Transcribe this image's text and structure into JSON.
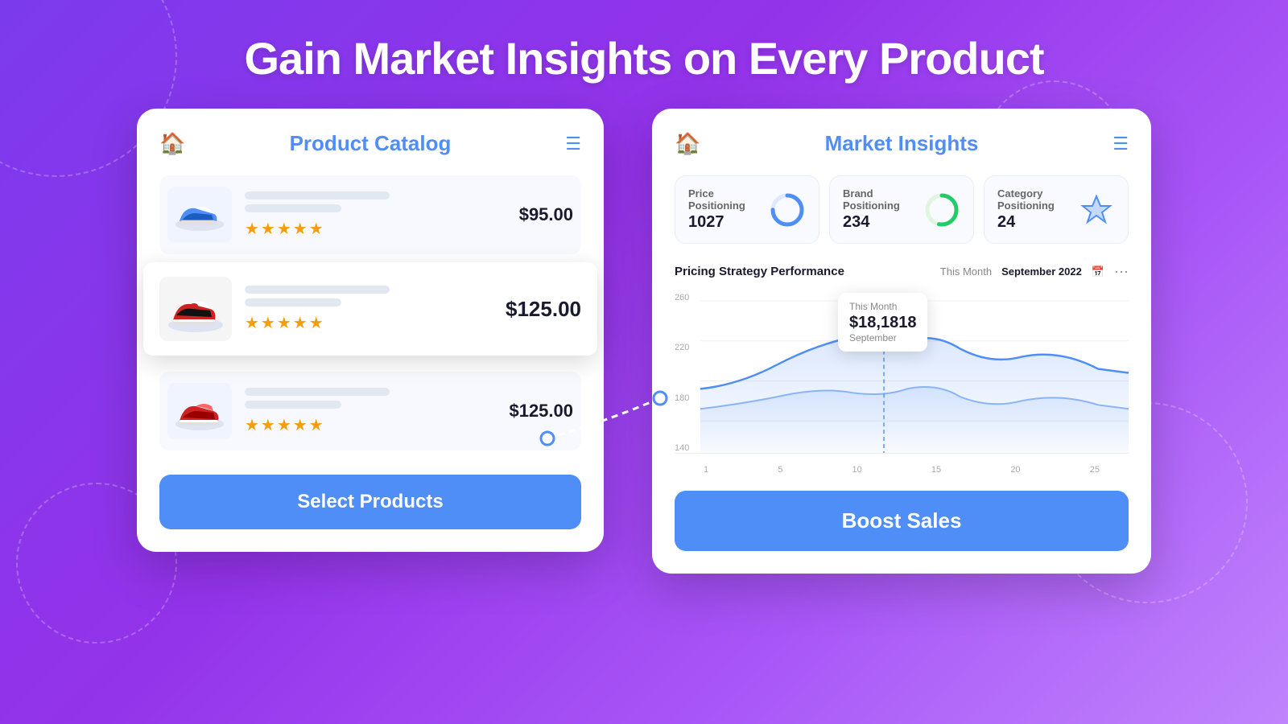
{
  "page": {
    "title": "Gain Market Insights on Every Product",
    "background_gradient": "linear-gradient(135deg, #7c3aed, #a855f7)"
  },
  "catalog_panel": {
    "title": "Product Catalog",
    "home_icon": "🏠",
    "menu_icon": "☰",
    "products": [
      {
        "id": 1,
        "price": "$95.00",
        "stars": "★★★★★",
        "active": false,
        "emoji": "👟"
      },
      {
        "id": 2,
        "price": "$125.00",
        "stars": "★★★★★",
        "active": true,
        "emoji": "👟"
      },
      {
        "id": 3,
        "price": "$125.00",
        "stars": "★★★★★",
        "active": false,
        "emoji": "👟"
      }
    ],
    "select_button": "Select Products"
  },
  "insights_panel": {
    "title": "Market Insights",
    "home_icon": "🏠",
    "menu_icon": "☰",
    "metrics": [
      {
        "label": "Price Positioning",
        "value": "1027",
        "icon_type": "donut_blue"
      },
      {
        "label": "Brand Positioning",
        "value": "234",
        "icon_type": "donut_green"
      },
      {
        "label": "Category Positioning",
        "value": "24",
        "icon_type": "arrow_blue"
      }
    ],
    "chart": {
      "title": "Pricing Strategy Performance",
      "period_label": "This Month",
      "date_label": "September 2022",
      "y_labels": [
        "260",
        "220",
        "180",
        "140"
      ],
      "x_labels": [
        "1",
        "5",
        "10",
        "15",
        "20",
        "25"
      ],
      "tooltip": {
        "label": "This Month",
        "value": "$18,1818",
        "sub": "September"
      }
    },
    "boost_button": "Boost Sales"
  }
}
